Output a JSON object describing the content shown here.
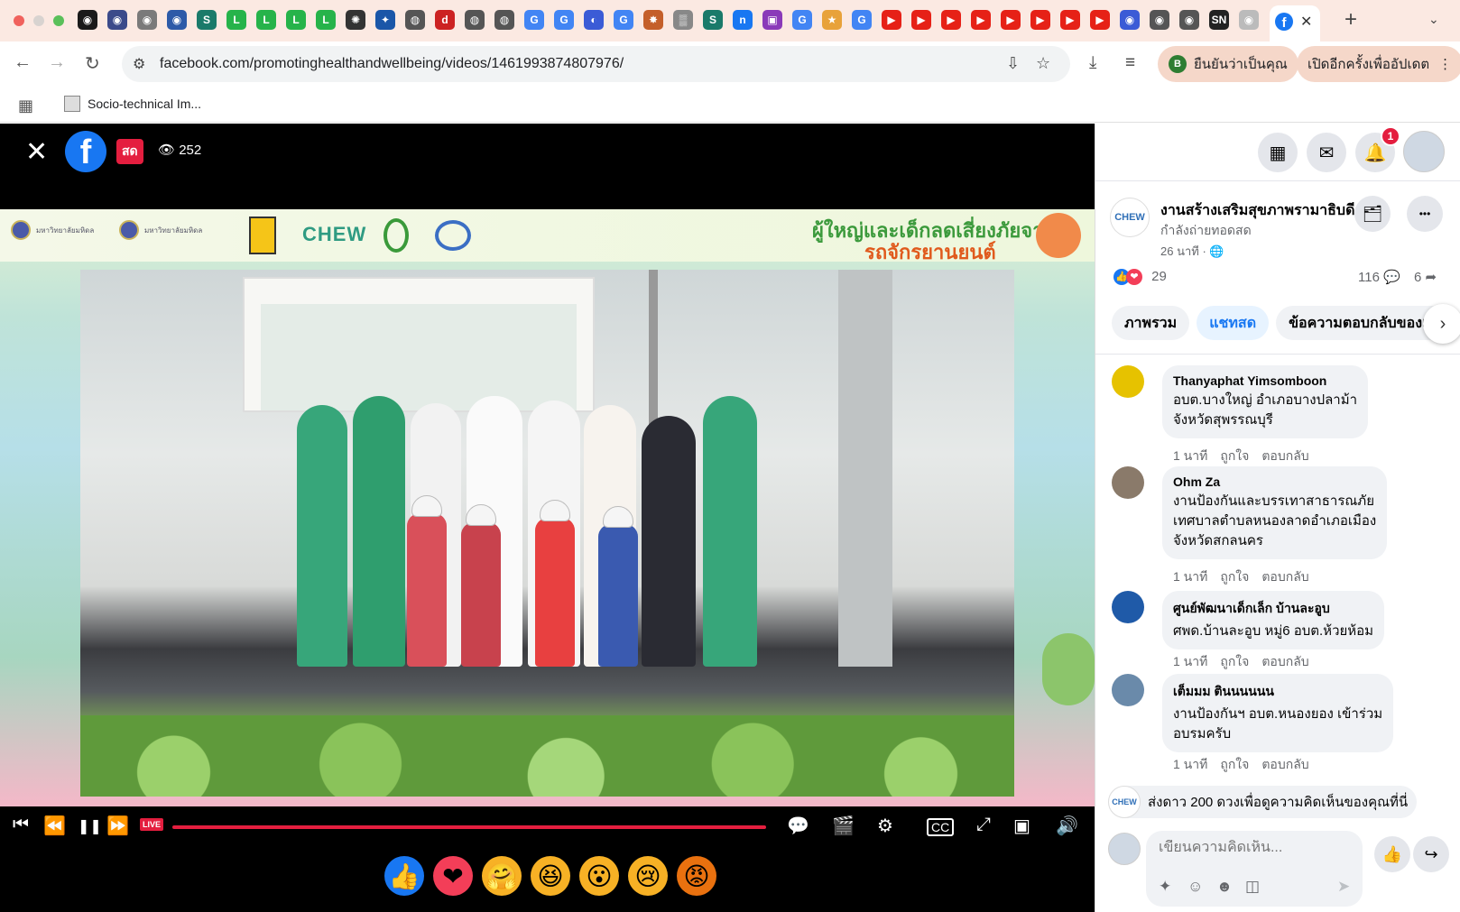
{
  "browser": {
    "tab_colors": [
      "#1a1a1a",
      "#3b4a8a",
      "#7a7a7a",
      "#2d5aa8",
      "#1a7a6a",
      "#26b34a",
      "#26b34a",
      "#26b34a",
      "#26b34a",
      "#333",
      "#1a56a8",
      "#555",
      "#cc2222",
      "#555",
      "#555",
      "#4285f4",
      "#4285f4",
      "#3b5bd6",
      "#4285f4",
      "#c45f2a",
      "#888",
      "#1a7a6a",
      "#1877f2",
      "#8a3ab9",
      "#4285f4",
      "#e8a23a",
      "#4285f4",
      "#e62117",
      "#e62117",
      "#e62117",
      "#e62117",
      "#e62117",
      "#e62117",
      "#e62117",
      "#e62117",
      "#3b5bd6",
      "#555",
      "#555",
      "#222",
      "#bbb"
    ],
    "tab_glyphs": [
      "◉",
      "◉",
      "◉",
      "◉",
      "S",
      "L",
      "L",
      "L",
      "L",
      "✺",
      "✦",
      "◍",
      "d",
      "◍",
      "◍",
      "G",
      "G",
      "◐",
      "G",
      "✸",
      "▒",
      "S",
      "n",
      "▣",
      "G",
      "★",
      "G",
      "▶",
      "▶",
      "▶",
      "▶",
      "▶",
      "▶",
      "▶",
      "▶",
      "◉",
      "◉",
      "◉",
      "SN",
      "◉"
    ],
    "active_tab_close": "✕",
    "new_tab": "+",
    "tab_menu": "⌄",
    "back": "←",
    "forward": "→",
    "reload": "↻",
    "url": "facebook.com/promotinghealthandwellbeing/videos/1461993874807976/",
    "verify_label": "ยืนยันว่าเป็นคุณ",
    "verify_badge": "B",
    "update_label": "เปิดอีกครั้งเพื่ออัปเดต",
    "update_more": "⋮",
    "apps_icon": "▦",
    "bookmark_label": "Socio-technical Im..."
  },
  "video": {
    "close": "✕",
    "fb_letter": "f",
    "live_badge": "สด",
    "view_count": "252",
    "eye": "👁",
    "banner_logo1": "มหาวิทยาลัยมหิดล",
    "banner_logo2": "มหาวิทยาลัยมหิดล",
    "banner_chew": "CHEW",
    "banner_title_line1": "ผู้ใหญ่และเด็กลดเสี่ยงภัยจาก",
    "banner_title_line2": "รถจักรยานยนต์",
    "controls": {
      "prev": "⏮",
      "rewind": "⏪",
      "pause": "❚❚",
      "forward": "⏩",
      "live": "LIVE",
      "chat": "💬",
      "clip": "🎬",
      "settings": "⚙",
      "cc": "CC",
      "expand": "⤢",
      "pip": "▣",
      "volume": "🔊"
    },
    "progress": 1.0,
    "reactions": [
      "👍",
      "❤",
      "🤗",
      "😆",
      "😮",
      "😢",
      "😡"
    ],
    "reaction_colors": [
      "#1877f2",
      "#f33e58",
      "#f7b125",
      "#f7b125",
      "#f7b125",
      "#f7b125",
      "#e9710f"
    ]
  },
  "panel": {
    "menu_icon": "▦",
    "messenger_icon": "✉",
    "bell_icon": "🔔",
    "notif_count": "1",
    "page_avatar": "CHEW",
    "page_name": "งานสร้างเสริมสุขภาพรามาธิบดี",
    "page_status": "กำลังถ่ายทอดสด",
    "page_time": "26 นาที · 🌐",
    "save_icon": "🗂",
    "more_icon": "•••",
    "reaction_count": "29",
    "comment_count": "116",
    "share_count": "6",
    "comment_icon": "💬",
    "share_icon": "➦",
    "tabs": [
      "ภาพรวม",
      "แชทสด",
      "ข้อความตอบกลับของเ..."
    ],
    "active_tab": 1,
    "tabs_next": "›",
    "comments": [
      {
        "name": "Thanyaphat Yimsomboon",
        "lines": [
          "อบต.บางใหญ่ อำเภอบางปลาม้า",
          "จังหวัดสุพรรณบุรี"
        ],
        "time": "1 นาที",
        "like": "ถูกใจ",
        "reply": "ตอบกลับ",
        "avatar": "#e6c200"
      },
      {
        "name": "Ohm Za",
        "lines": [
          "งานป้องกันและบรรเทาสาธารณภัย",
          "เทศบาลตำบลหนองลาดอำเภอเมือง",
          "จังหวัดสกลนคร"
        ],
        "time": "1 นาที",
        "like": "ถูกใจ",
        "reply": "ตอบกลับ",
        "avatar": "#8a7a6a"
      },
      {
        "name": "ศูนย์พัฒนาเด็กเล็ก บ้านละอูบ",
        "lines": [
          "ศพด.บ้านละอูบ หมู่6 อบต.ห้วยห้อม"
        ],
        "time": "1 นาที",
        "like": "ถูกใจ",
        "reply": "ตอบกลับ",
        "avatar": "#1f5aa8"
      },
      {
        "name": "เต็มมม ตินนนนนน",
        "lines": [
          "งานป้องกันฯ อบต.หนองยอง เข้าร่วม",
          "อบรมครับ"
        ],
        "time": "1 นาที",
        "like": "ถูกใจ",
        "reply": "ตอบกลับ",
        "avatar": "#6a8aaa"
      }
    ],
    "stars_prompt": "ส่งดาว 200 ดวงเพื่อดูความคิดเห็นของคุณที่นี่",
    "compose_placeholder": "เขียนความคิดเห็น...",
    "compose_icons": [
      "✦",
      "☺",
      "☻",
      "◫"
    ],
    "send_icon": "➤",
    "like_button": "👍",
    "share_button": "↪"
  }
}
